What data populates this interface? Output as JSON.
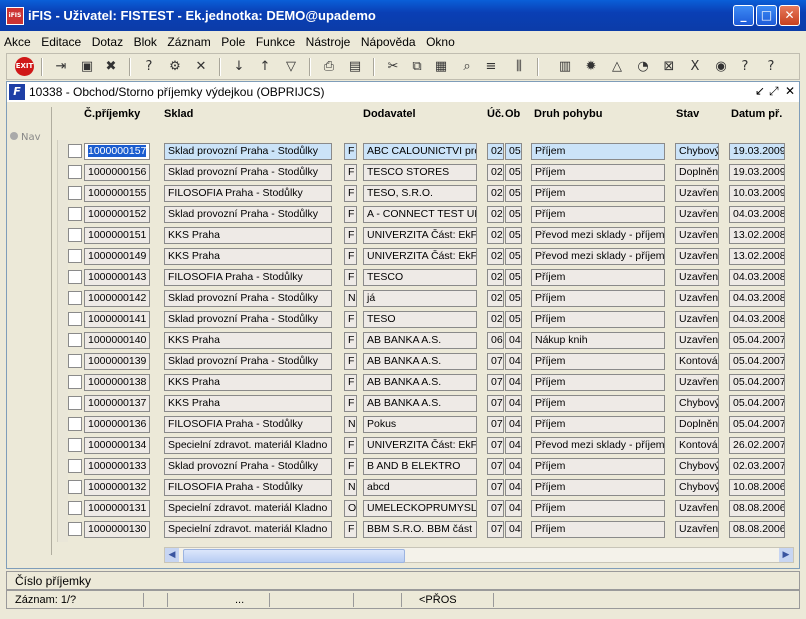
{
  "window": {
    "title": "iFIS - Uživatel: FISTEST - Ek.jednotka: DEMO@upademo",
    "app_icon": "iFIS",
    "minimize": "_",
    "maximize": "□",
    "close": "✕"
  },
  "menu": [
    "Akce",
    "Editace",
    "Dotaz",
    "Blok",
    "Záznam",
    "Pole",
    "Funkce",
    "Nástroje",
    "Nápověda",
    "Okno"
  ],
  "toolbar": {
    "exit_label": "EXIT",
    "icons": [
      "exit-icon",
      "new-record-icon",
      "save-icon",
      "delete-icon",
      "enter-query-icon",
      "execute-query-icon",
      "cancel-query-icon",
      "sort-asc-icon",
      "sort-desc-icon",
      "filter-icon",
      "print-icon",
      "print-preview-icon",
      "cut-icon",
      "copy-icon",
      "paste-icon",
      "find-icon",
      "list-icon",
      "columns-icon",
      "calculator-icon",
      "settings-icon",
      "chart-icon",
      "clock-icon",
      "excel-icon",
      "export-icon",
      "help-topics-icon",
      "help-icon"
    ]
  },
  "form": {
    "title": "10338 - Obchod/Storno příjemky výdejkou (OBPRIJCS)",
    "nav_label": "Nav",
    "controls": [
      "↙",
      "⤢",
      "✕"
    ]
  },
  "columns": {
    "cislo": "Č.příjemky",
    "sklad": "Sklad",
    "dodavatel": "Dodavatel",
    "uc": "Úč.",
    "ob": "Ob",
    "druh": "Druh pohybu",
    "stav": "Stav",
    "datum": "Datum př."
  },
  "rows": [
    {
      "cislo": "1000000157",
      "sklad": "Sklad provozní Praha - Stodůlky",
      "typ": "F",
      "dodavatel": "ABC CALOUNICTVI pro",
      "uc": "02",
      "ob": "05",
      "druh": "Příjem",
      "stav": "Chybový",
      "datum": "19.03.2009"
    },
    {
      "cislo": "1000000156",
      "sklad": "Sklad provozní Praha - Stodůlky",
      "typ": "F",
      "dodavatel": "TESCO STORES",
      "uc": "02",
      "ob": "05",
      "druh": "Příjem",
      "stav": "Doplněn",
      "datum": "19.03.2009"
    },
    {
      "cislo": "1000000155",
      "sklad": "FILOSOFIA Praha - Stodůlky",
      "typ": "F",
      "dodavatel": "TESO, S.R.O.",
      "uc": "02",
      "ob": "05",
      "druh": "Příjem",
      "stav": "Uzavřen",
      "datum": "10.03.2009"
    },
    {
      "cislo": "1000000152",
      "sklad": "Sklad provozní Praha - Stodůlky",
      "typ": "F",
      "dodavatel": "A - CONNECT TEST UN",
      "uc": "02",
      "ob": "05",
      "druh": "Příjem",
      "stav": "Uzavřen",
      "datum": "04.03.2008"
    },
    {
      "cislo": "1000000151",
      "sklad": "KKS Praha",
      "typ": "F",
      "dodavatel": "UNIVERZITA Část: EkF",
      "uc": "02",
      "ob": "05",
      "druh": "Převod mezi sklady - příjem",
      "stav": "Uzavřen",
      "datum": "13.02.2008"
    },
    {
      "cislo": "1000000149",
      "sklad": "KKS Praha",
      "typ": "F",
      "dodavatel": "UNIVERZITA Část: EkF",
      "uc": "02",
      "ob": "05",
      "druh": "Převod mezi sklady - příjem",
      "stav": "Uzavřen",
      "datum": "13.02.2008"
    },
    {
      "cislo": "1000000143",
      "sklad": "FILOSOFIA Praha - Stodůlky",
      "typ": "F",
      "dodavatel": "TESCO",
      "uc": "02",
      "ob": "05",
      "druh": "Příjem",
      "stav": "Uzavřen",
      "datum": "04.03.2008"
    },
    {
      "cislo": "1000000142",
      "sklad": "Sklad provozní Praha - Stodůlky",
      "typ": "N",
      "dodavatel": "já",
      "uc": "02",
      "ob": "05",
      "druh": "Příjem",
      "stav": "Uzavřen",
      "datum": "04.03.2008"
    },
    {
      "cislo": "1000000141",
      "sklad": "Sklad provozní Praha - Stodůlky",
      "typ": "F",
      "dodavatel": " TESO",
      "uc": "02",
      "ob": "05",
      "druh": "Příjem",
      "stav": "Uzavřen",
      "datum": "04.03.2008"
    },
    {
      "cislo": "1000000140",
      "sklad": "KKS Praha",
      "typ": "F",
      "dodavatel": "AB BANKA A.S.",
      "uc": "06",
      "ob": "04",
      "druh": "Nákup knih",
      "stav": "Uzavřen",
      "datum": "05.04.2007"
    },
    {
      "cislo": "1000000139",
      "sklad": "Sklad provozní Praha - Stodůlky",
      "typ": "F",
      "dodavatel": "AB BANKA A.S.",
      "uc": "07",
      "ob": "04",
      "druh": "Příjem",
      "stav": "Kontová",
      "datum": "05.04.2007"
    },
    {
      "cislo": "1000000138",
      "sklad": "KKS Praha",
      "typ": "F",
      "dodavatel": "AB BANKA A.S.",
      "uc": "07",
      "ob": "04",
      "druh": "Příjem",
      "stav": "Uzavřen",
      "datum": "05.04.2007"
    },
    {
      "cislo": "1000000137",
      "sklad": "KKS Praha",
      "typ": "F",
      "dodavatel": "AB BANKA A.S.",
      "uc": "07",
      "ob": "04",
      "druh": "Příjem",
      "stav": "Chybový",
      "datum": "05.04.2007"
    },
    {
      "cislo": "1000000136",
      "sklad": "FILOSOFIA Praha - Stodůlky",
      "typ": "N",
      "dodavatel": "Pokus",
      "uc": "07",
      "ob": "04",
      "druh": "Příjem",
      "stav": "Doplněn",
      "datum": "05.04.2007"
    },
    {
      "cislo": "1000000134",
      "sklad": "Specielní zdravot. materiál Kladno",
      "typ": "F",
      "dodavatel": "UNIVERZITA Část: EkF",
      "uc": "07",
      "ob": "04",
      "druh": "Převod mezi sklady - příjem",
      "stav": "Kontová",
      "datum": "26.02.2007"
    },
    {
      "cislo": "1000000133",
      "sklad": "Sklad provozní Praha - Stodůlky",
      "typ": "F",
      "dodavatel": "B AND B ELEKTRO",
      "uc": "07",
      "ob": "04",
      "druh": "Příjem",
      "stav": "Chybový",
      "datum": "02.03.2007"
    },
    {
      "cislo": "1000000132",
      "sklad": "FILOSOFIA Praha - Stodůlky",
      "typ": "N",
      "dodavatel": "abcd",
      "uc": "07",
      "ob": "04",
      "druh": "Příjem",
      "stav": "Chybový",
      "datum": "10.08.2006"
    },
    {
      "cislo": "1000000131",
      "sklad": "Specielní zdravot. materiál Kladno",
      "typ": "O",
      "dodavatel": "UMELECKOPRUMYSLC",
      "uc": "07",
      "ob": "04",
      "druh": "Příjem",
      "stav": "Uzavřen",
      "datum": "08.08.2006"
    },
    {
      "cislo": "1000000130",
      "sklad": "Specielní zdravot. materiál Kladno",
      "typ": "F",
      "dodavatel": "BBM S.R.O. BBM část",
      "uc": "07",
      "ob": "04",
      "druh": "Příjem",
      "stav": "Uzavřen",
      "datum": "08.08.2006"
    }
  ],
  "hint": "Číslo příjemky",
  "status": {
    "record": "Záznam: 1/?",
    "dots": "...",
    "mode": "<PŘOS"
  },
  "colors": {
    "title_bar": "#0a4fc6",
    "selection": "#1a5ccf",
    "current_row": "#cbe3f8"
  }
}
